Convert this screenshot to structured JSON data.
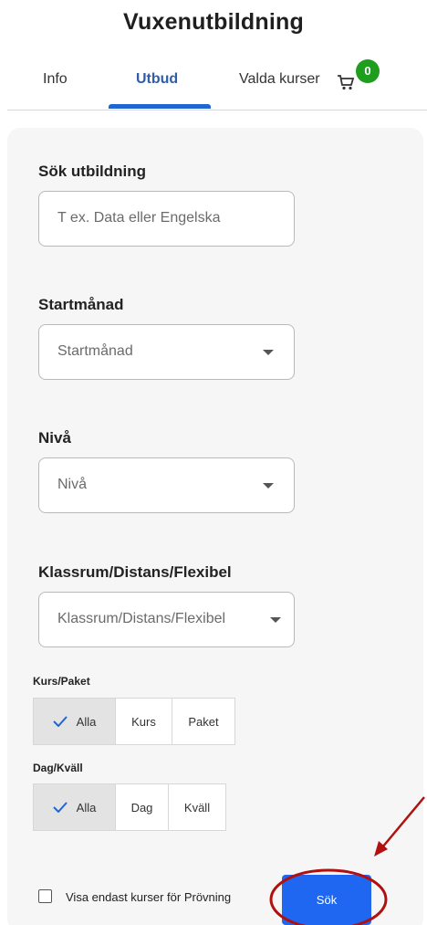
{
  "header": {
    "title": "Vuxenutbildning"
  },
  "tabs": [
    {
      "label": "Info",
      "active": false
    },
    {
      "label": "Utbud",
      "active": true
    },
    {
      "label": "Valda kurser",
      "active": false
    }
  ],
  "cart": {
    "count": "0",
    "icon": "shopping-cart-icon",
    "badge_color": "#1f9d1f"
  },
  "search": {
    "label": "Sök utbildning",
    "placeholder": "T ex. Data eller Engelska"
  },
  "start_month": {
    "label": "Startmånad",
    "value": "Startmånad"
  },
  "level": {
    "label": "Nivå",
    "value": "Nivå"
  },
  "mode": {
    "label": "Klassrum/Distans/Flexibel",
    "value": "Klassrum/Distans/Flexibel"
  },
  "kurs_paket": {
    "label": "Kurs/Paket",
    "options": [
      "Alla",
      "Kurs",
      "Paket"
    ],
    "selected": "Alla"
  },
  "dag_kvall": {
    "label": "Dag/Kväll",
    "options": [
      "Alla",
      "Dag",
      "Kväll"
    ],
    "selected": "Alla"
  },
  "provning": {
    "label": "Visa endast kurser för Prövning",
    "checked": false
  },
  "submit": {
    "label": "Sök"
  },
  "colors": {
    "accent": "#1f66d1",
    "button": "#1f66f0",
    "annotation": "#b01010"
  }
}
